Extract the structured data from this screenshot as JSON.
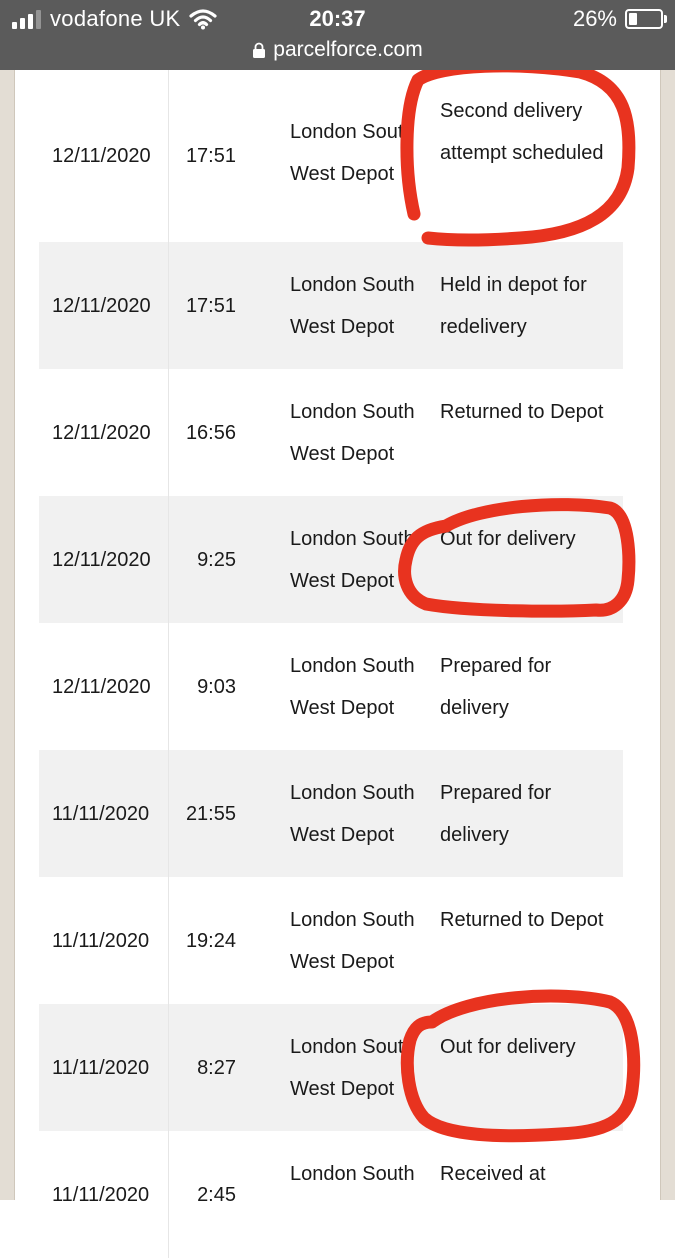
{
  "status_bar": {
    "carrier": "vodafone UK",
    "time": "20:37",
    "battery_percent": "26%",
    "battery_level": 0.26,
    "signal_bars": 3,
    "url": "parcelforce.com"
  },
  "tracking": {
    "rows": [
      {
        "date": "12/11/2020",
        "time": "17:51",
        "location": "London South West Depot",
        "status": "Second delivery attempt scheduled"
      },
      {
        "date": "12/11/2020",
        "time": "17:51",
        "location": "London South West Depot",
        "status": "Held in depot for redelivery"
      },
      {
        "date": "12/11/2020",
        "time": "16:56",
        "location": "London South West Depot",
        "status": "Returned to Depot"
      },
      {
        "date": "12/11/2020",
        "time": "9:25",
        "location": "London South West Depot",
        "status": "Out for delivery"
      },
      {
        "date": "12/11/2020",
        "time": "9:03",
        "location": "London South West Depot",
        "status": "Prepared for delivery"
      },
      {
        "date": "11/11/2020",
        "time": "21:55",
        "location": "London South West Depot",
        "status": "Prepared for delivery"
      },
      {
        "date": "11/11/2020",
        "time": "19:24",
        "location": "London South West Depot",
        "status": "Returned to Depot"
      },
      {
        "date": "11/11/2020",
        "time": "8:27",
        "location": "London South West Depot",
        "status": "Out for delivery"
      },
      {
        "date": "11/11/2020",
        "time": "2:45",
        "location": "London South",
        "status": "Received at"
      }
    ]
  },
  "annotation_color": "#e8331f"
}
